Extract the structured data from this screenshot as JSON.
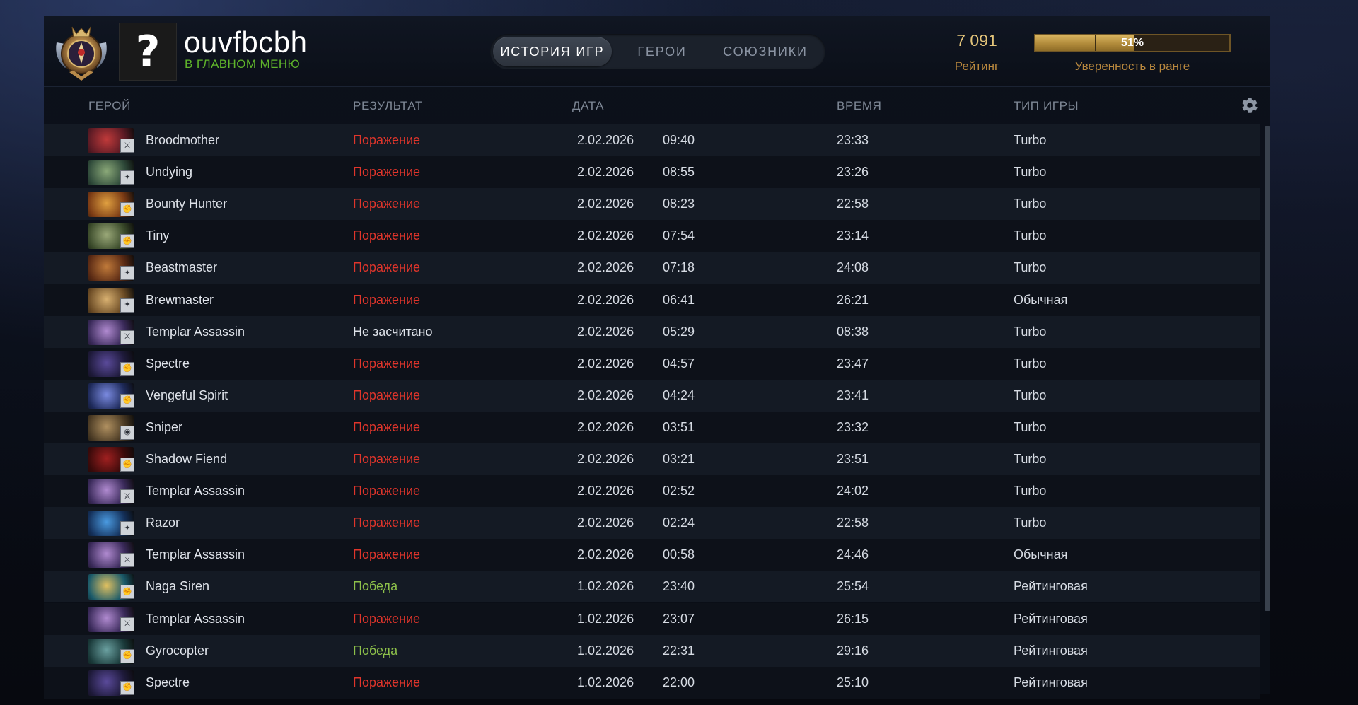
{
  "header": {
    "player_name": "ouvfbcbh",
    "player_status": "В ГЛАВНОМ МЕНЮ",
    "avatar_glyph": "?",
    "tabs": [
      {
        "label": "ИСТОРИЯ ИГР",
        "active": true
      },
      {
        "label": "ГЕРОИ",
        "active": false
      },
      {
        "label": "СОЮЗНИКИ",
        "active": false
      }
    ],
    "rating_value": "7 091",
    "rating_label": "Рейтинг",
    "confidence_percent": 51,
    "confidence_text": "51%",
    "confidence_label": "Уверенность в ранге"
  },
  "columns": {
    "hero": "ГЕРОЙ",
    "result": "РЕЗУЛЬТАТ",
    "date": "ДАТА",
    "duration": "ВРЕМЯ",
    "game_type": "ТИП ИГРЫ"
  },
  "colors": {
    "loss": "#e0352b",
    "win": "#8dc04a",
    "accent_gold": "#e3c47a",
    "status_green": "#5fb52b"
  },
  "matches": [
    {
      "hero": "Broodmother",
      "result": "Поражение",
      "outcome": "loss",
      "date": "2.02.2026",
      "time": "09:40",
      "duration": "23:33",
      "type": "Turbo"
    },
    {
      "hero": "Undying",
      "result": "Поражение",
      "outcome": "loss",
      "date": "2.02.2026",
      "time": "08:55",
      "duration": "23:26",
      "type": "Turbo"
    },
    {
      "hero": "Bounty Hunter",
      "result": "Поражение",
      "outcome": "loss",
      "date": "2.02.2026",
      "time": "08:23",
      "duration": "22:58",
      "type": "Turbo"
    },
    {
      "hero": "Tiny",
      "result": "Поражение",
      "outcome": "loss",
      "date": "2.02.2026",
      "time": "07:54",
      "duration": "23:14",
      "type": "Turbo"
    },
    {
      "hero": "Beastmaster",
      "result": "Поражение",
      "outcome": "loss",
      "date": "2.02.2026",
      "time": "07:18",
      "duration": "24:08",
      "type": "Turbo"
    },
    {
      "hero": "Brewmaster",
      "result": "Поражение",
      "outcome": "loss",
      "date": "2.02.2026",
      "time": "06:41",
      "duration": "26:21",
      "type": "Обычная"
    },
    {
      "hero": "Templar Assassin",
      "result": "Не засчитано",
      "outcome": "none",
      "date": "2.02.2026",
      "time": "05:29",
      "duration": "08:38",
      "type": "Turbo"
    },
    {
      "hero": "Spectre",
      "result": "Поражение",
      "outcome": "loss",
      "date": "2.02.2026",
      "time": "04:57",
      "duration": "23:47",
      "type": "Turbo"
    },
    {
      "hero": "Vengeful Spirit",
      "result": "Поражение",
      "outcome": "loss",
      "date": "2.02.2026",
      "time": "04:24",
      "duration": "23:41",
      "type": "Turbo"
    },
    {
      "hero": "Sniper",
      "result": "Поражение",
      "outcome": "loss",
      "date": "2.02.2026",
      "time": "03:51",
      "duration": "23:32",
      "type": "Turbo"
    },
    {
      "hero": "Shadow Fiend",
      "result": "Поражение",
      "outcome": "loss",
      "date": "2.02.2026",
      "time": "03:21",
      "duration": "23:51",
      "type": "Turbo"
    },
    {
      "hero": "Templar Assassin",
      "result": "Поражение",
      "outcome": "loss",
      "date": "2.02.2026",
      "time": "02:52",
      "duration": "24:02",
      "type": "Turbo"
    },
    {
      "hero": "Razor",
      "result": "Поражение",
      "outcome": "loss",
      "date": "2.02.2026",
      "time": "02:24",
      "duration": "22:58",
      "type": "Turbo"
    },
    {
      "hero": "Templar Assassin",
      "result": "Поражение",
      "outcome": "loss",
      "date": "2.02.2026",
      "time": "00:58",
      "duration": "24:46",
      "type": "Обычная"
    },
    {
      "hero": "Naga Siren",
      "result": "Победа",
      "outcome": "win",
      "date": "1.02.2026",
      "time": "23:40",
      "duration": "25:54",
      "type": "Рейтинговая"
    },
    {
      "hero": "Templar Assassin",
      "result": "Поражение",
      "outcome": "loss",
      "date": "1.02.2026",
      "time": "23:07",
      "duration": "26:15",
      "type": "Рейтинговая"
    },
    {
      "hero": "Gyrocopter",
      "result": "Победа",
      "outcome": "win",
      "date": "1.02.2026",
      "time": "22:31",
      "duration": "29:16",
      "type": "Рейтинговая"
    },
    {
      "hero": "Spectre",
      "result": "Поражение",
      "outcome": "loss",
      "date": "1.02.2026",
      "time": "22:00",
      "duration": "25:10",
      "type": "Рейтинговая"
    }
  ]
}
